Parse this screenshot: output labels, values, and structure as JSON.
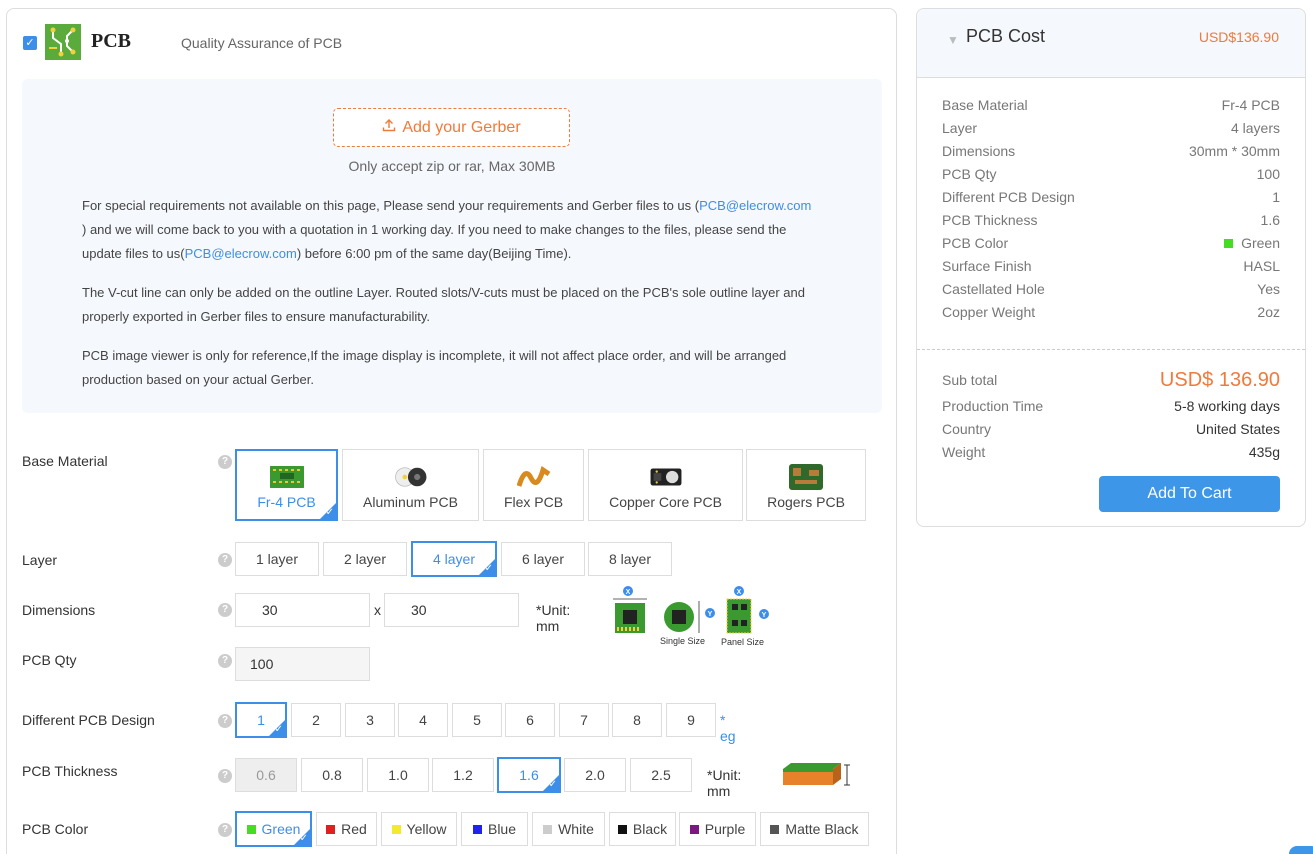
{
  "header": {
    "checked": true,
    "title": "PCB",
    "subtitle": "Quality Assurance of PCB"
  },
  "upload": {
    "button_label": "Add your Gerber",
    "note": "Only accept zip or rar, Max 30MB",
    "paragraph1_a": "For special requirements not available on this page, Please send your requirements and Gerber files to us (",
    "email1": "PCB@elecrow.com",
    "paragraph1_b": " ) and we will come back to you with a quotation in 1 working day. If you need to make changes to the files, please send the update files to us(",
    "email2": "PCB@elecrow.com",
    "paragraph1_c": ") before 6:00 pm of the same day(Beijing Time).",
    "paragraph2": "The V-cut line can only be added on the outline Layer. Routed slots/V-cuts must be placed on the PCB's sole outline layer and properly exported in Gerber files to ensure manufacturability.",
    "paragraph3": "PCB image viewer is only for reference,If the image display is incomplete, it will not affect place order, and will be arranged production based on your actual Gerber."
  },
  "form": {
    "help_glyph": "?",
    "tick_glyph": "✓",
    "base_material": {
      "label": "Base Material",
      "options": [
        "Fr-4 PCB",
        "Aluminum PCB",
        "Flex PCB",
        "Copper Core PCB",
        "Rogers PCB"
      ],
      "selected": "Fr-4 PCB"
    },
    "layer": {
      "label": "Layer",
      "options": [
        "1 layer",
        "2 layer",
        "4 layer",
        "6 layer",
        "8 layer"
      ],
      "selected": "4 layer"
    },
    "dimensions": {
      "label": "Dimensions",
      "x_value": "30",
      "separator": "x",
      "y_value": "30",
      "unit": "*Unit: mm",
      "single_size_caption": "Single Size",
      "panel_size_caption": "Panel Size",
      "x_badge": "X",
      "y_badge": "Y"
    },
    "pcb_qty": {
      "label": "PCB Qty",
      "value": "100"
    },
    "different_design": {
      "label": "Different PCB Design",
      "options": [
        "1",
        "2",
        "3",
        "4",
        "5",
        "6",
        "7",
        "8",
        "9"
      ],
      "selected": "1",
      "eg_label": "* eg"
    },
    "thickness": {
      "label": "PCB Thickness",
      "options": [
        "0.6",
        "0.8",
        "1.0",
        "1.2",
        "1.6",
        "2.0",
        "2.5"
      ],
      "selected": "1.6",
      "disabled": "0.6",
      "unit": "*Unit: mm"
    },
    "color": {
      "label": "PCB Color",
      "options": [
        {
          "name": "Green",
          "hex": "#44dd22"
        },
        {
          "name": "Red",
          "hex": "#e02020"
        },
        {
          "name": "Yellow",
          "hex": "#f2ea2a"
        },
        {
          "name": "Blue",
          "hex": "#2222ee"
        },
        {
          "name": "White",
          "hex": "#cccccc"
        },
        {
          "name": "Black",
          "hex": "#111111"
        },
        {
          "name": "Purple",
          "hex": "#7a1a80"
        },
        {
          "name": "Matte Black",
          "hex": "#555555"
        }
      ],
      "selected": "Green"
    }
  },
  "cost": {
    "title": "PCB Cost",
    "total_header": "USD$136.90",
    "items": [
      {
        "label": "Base Material",
        "value": "Fr-4 PCB"
      },
      {
        "label": "Layer",
        "value": "4 layers"
      },
      {
        "label": "Dimensions",
        "value": "30mm * 30mm"
      },
      {
        "label": "PCB Qty",
        "value": "100"
      },
      {
        "label": "Different PCB Design",
        "value": "1"
      },
      {
        "label": "PCB Thickness",
        "value": "1.6"
      },
      {
        "label": "PCB Color",
        "value": "Green",
        "swatch": "#44dd22"
      },
      {
        "label": "Surface Finish",
        "value": "HASL"
      },
      {
        "label": "Castellated Hole",
        "value": "Yes"
      },
      {
        "label": "Copper Weight",
        "value": "2oz"
      }
    ],
    "subtotal_label": "Sub total",
    "subtotal_value": "USD$ 136.90",
    "production_label": "Production Time",
    "production_value": "5-8 working days",
    "country_label": "Country",
    "country_value": "United States",
    "weight_label": "Weight",
    "weight_value": "435g",
    "cart_button": "Add To Cart"
  },
  "colors": {
    "accent": "#3d8ee8",
    "orange": "#f07a3a"
  }
}
